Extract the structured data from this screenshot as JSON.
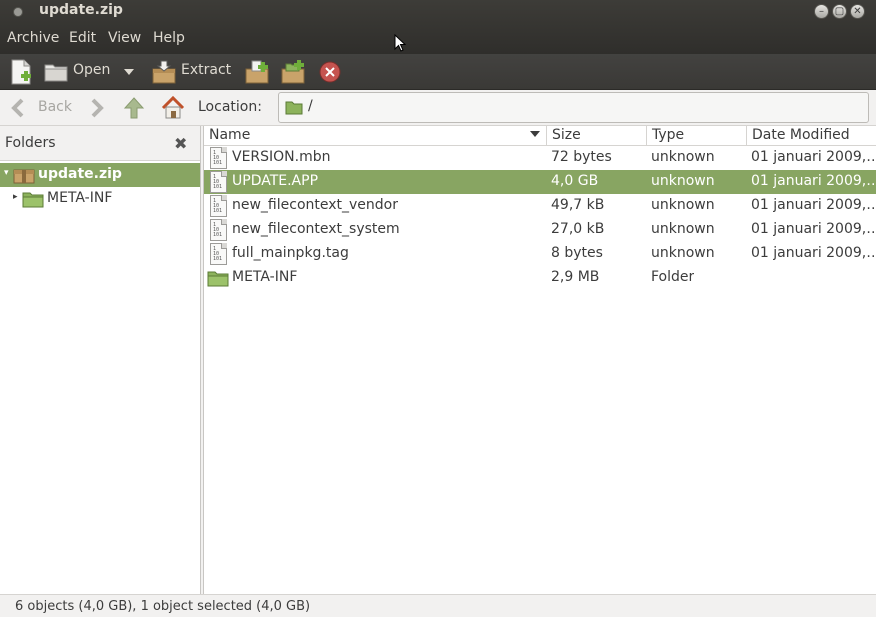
{
  "window": {
    "title": "update.zip",
    "controls": [
      "–",
      "▢",
      "✕"
    ]
  },
  "menubar": {
    "items": [
      "Archive",
      "Edit",
      "View",
      "Help"
    ]
  },
  "toolbar": {
    "open_label": "Open",
    "extract_label": "Extract",
    "icons": [
      "new-archive-icon",
      "folder-icon",
      "dropdown-arrow-icon",
      "extract-icon",
      "add-files-icon",
      "add-folder-icon",
      "stop-icon"
    ]
  },
  "navigation": {
    "back_label": "Back",
    "location_label": "Location:",
    "location_value": "/"
  },
  "folders_pane": {
    "title": "Folders",
    "tree": [
      {
        "label": "update.zip",
        "selected": true,
        "expanded": true,
        "icon": "archive-icon"
      },
      {
        "label": "META-INF",
        "selected": false,
        "expanded": false,
        "icon": "folder-icon"
      }
    ]
  },
  "file_list": {
    "columns": [
      "Name",
      "Size",
      "Type",
      "Date Modified"
    ],
    "rows": [
      {
        "name": "VERSION.mbn",
        "size": "72 bytes",
        "type": "unknown",
        "date": "01 januari 2009,…",
        "icon": "binary-file-icon",
        "selected": false
      },
      {
        "name": "UPDATE.APP",
        "size": "4,0 GB",
        "type": "unknown",
        "date": "01 januari 2009,…",
        "icon": "binary-file-icon",
        "selected": true
      },
      {
        "name": "new_filecontext_vendor",
        "size": "49,7 kB",
        "type": "unknown",
        "date": "01 januari 2009,…",
        "icon": "binary-file-icon",
        "selected": false
      },
      {
        "name": "new_filecontext_system",
        "size": "27,0 kB",
        "type": "unknown",
        "date": "01 januari 2009,…",
        "icon": "binary-file-icon",
        "selected": false
      },
      {
        "name": "full_mainpkg.tag",
        "size": "8 bytes",
        "type": "unknown",
        "date": "01 januari 2009,…",
        "icon": "binary-file-icon",
        "selected": false
      },
      {
        "name": "META-INF",
        "size": "2,9 MB",
        "type": "Folder",
        "date": "",
        "icon": "folder-icon",
        "selected": false
      }
    ]
  },
  "status": {
    "text": "6 objects (4,0 GB), 1 object selected (4,0 GB)"
  },
  "colors": {
    "selection": "#88a562",
    "folder_green": "#8db35c",
    "titlebar": "#3d3c38"
  }
}
